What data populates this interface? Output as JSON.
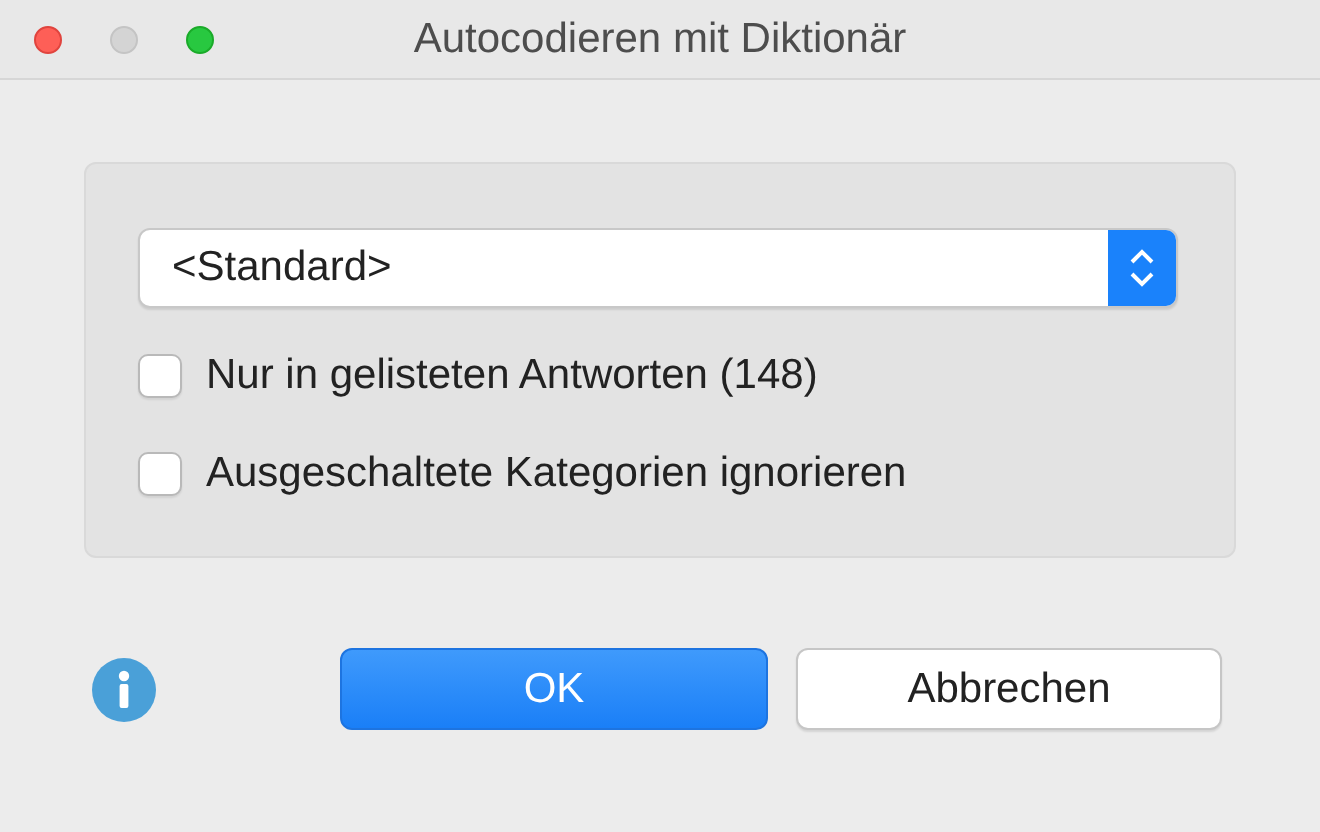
{
  "window": {
    "title": "Autocodieren mit Diktionär"
  },
  "popup": {
    "value": "<Standard>"
  },
  "options": [
    {
      "label": "Nur in gelisteten Antworten (148)",
      "checked": false
    },
    {
      "label": "Ausgeschaltete Kategorien ignorieren",
      "checked": false
    }
  ],
  "buttons": [
    {
      "label": "OK",
      "kind": "default"
    },
    {
      "label": "Abbrechen",
      "kind": "normal"
    }
  ]
}
